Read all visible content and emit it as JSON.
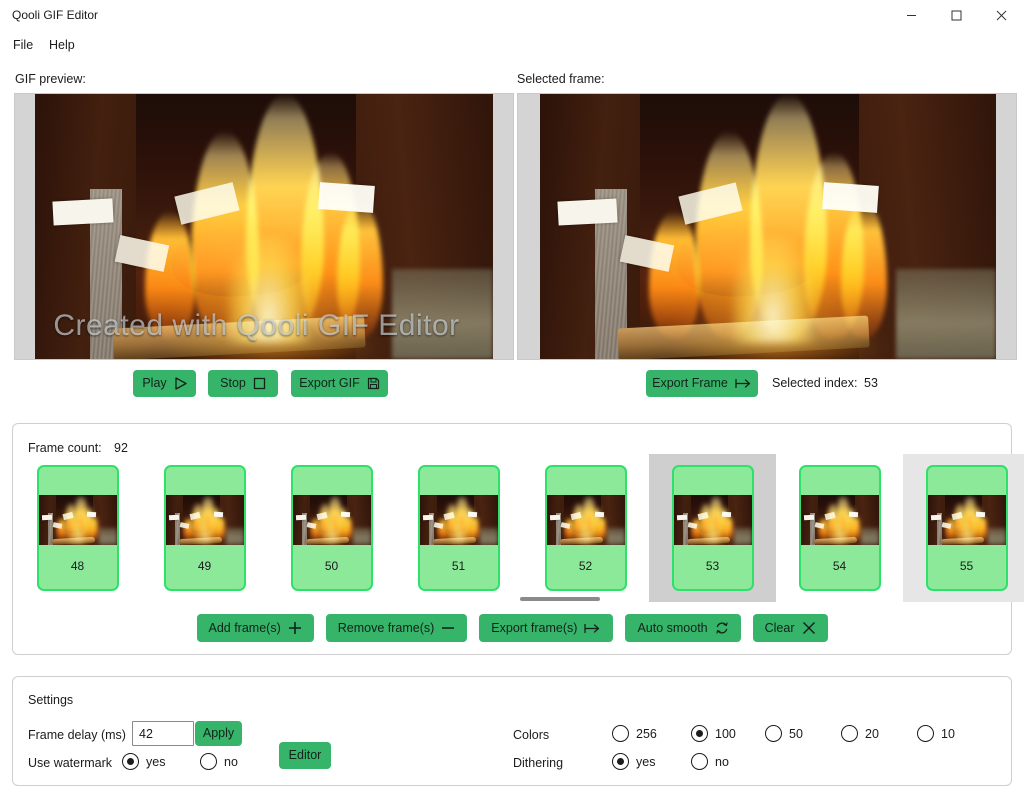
{
  "window": {
    "title": "Qooli GIF Editor",
    "controls": {
      "minimize": "–",
      "maximize": "☐",
      "close": "✕"
    }
  },
  "menu": {
    "file": "File",
    "help": "Help"
  },
  "labels": {
    "gif_preview": "GIF preview:",
    "selected_frame": "Selected frame:",
    "selected_index": "Selected index:",
    "selected_index_value": "53",
    "frame_count": "Frame count:",
    "frame_count_value": "92"
  },
  "preview": {
    "watermark_text": "Created with Qooli GIF Editor"
  },
  "preview_buttons": {
    "play": "Play",
    "stop": "Stop",
    "export_gif": "Export GIF",
    "export_frame": "Export Frame"
  },
  "frames": {
    "items": [
      {
        "index": "48",
        "state": "normal"
      },
      {
        "index": "49",
        "state": "normal"
      },
      {
        "index": "50",
        "state": "normal"
      },
      {
        "index": "51",
        "state": "normal"
      },
      {
        "index": "52",
        "state": "normal"
      },
      {
        "index": "53",
        "state": "selected"
      },
      {
        "index": "54",
        "state": "normal"
      },
      {
        "index": "55",
        "state": "hover"
      }
    ],
    "actions": {
      "add": "Add frame(s)",
      "remove": "Remove frame(s)",
      "export": "Export frame(s)",
      "auto_smooth": "Auto smooth",
      "clear": "Clear"
    }
  },
  "settings": {
    "title": "Settings",
    "frame_delay_label": "Frame delay (ms)",
    "frame_delay_value": "42",
    "apply_label": "Apply",
    "watermark_label": "Use watermark",
    "watermark_yes": "yes",
    "watermark_no": "no",
    "watermark_selected": "yes",
    "editor_label": "Editor",
    "colors_label": "Colors",
    "colors_options": [
      "256",
      "100",
      "50",
      "20",
      "10"
    ],
    "colors_selected": "100",
    "dithering_label": "Dithering",
    "dithering_yes": "yes",
    "dithering_no": "no",
    "dithering_selected": "yes"
  },
  "theme": {
    "accent_green": "#35b46a",
    "frame_card_fill": "#8ce99a",
    "frame_card_border": "#2fe06a",
    "selection_gray": "#cfcfcf",
    "hover_gray": "#e6e6e6",
    "panel_border": "#cfcfcf",
    "letterbox_gray": "#d4d4d4"
  }
}
